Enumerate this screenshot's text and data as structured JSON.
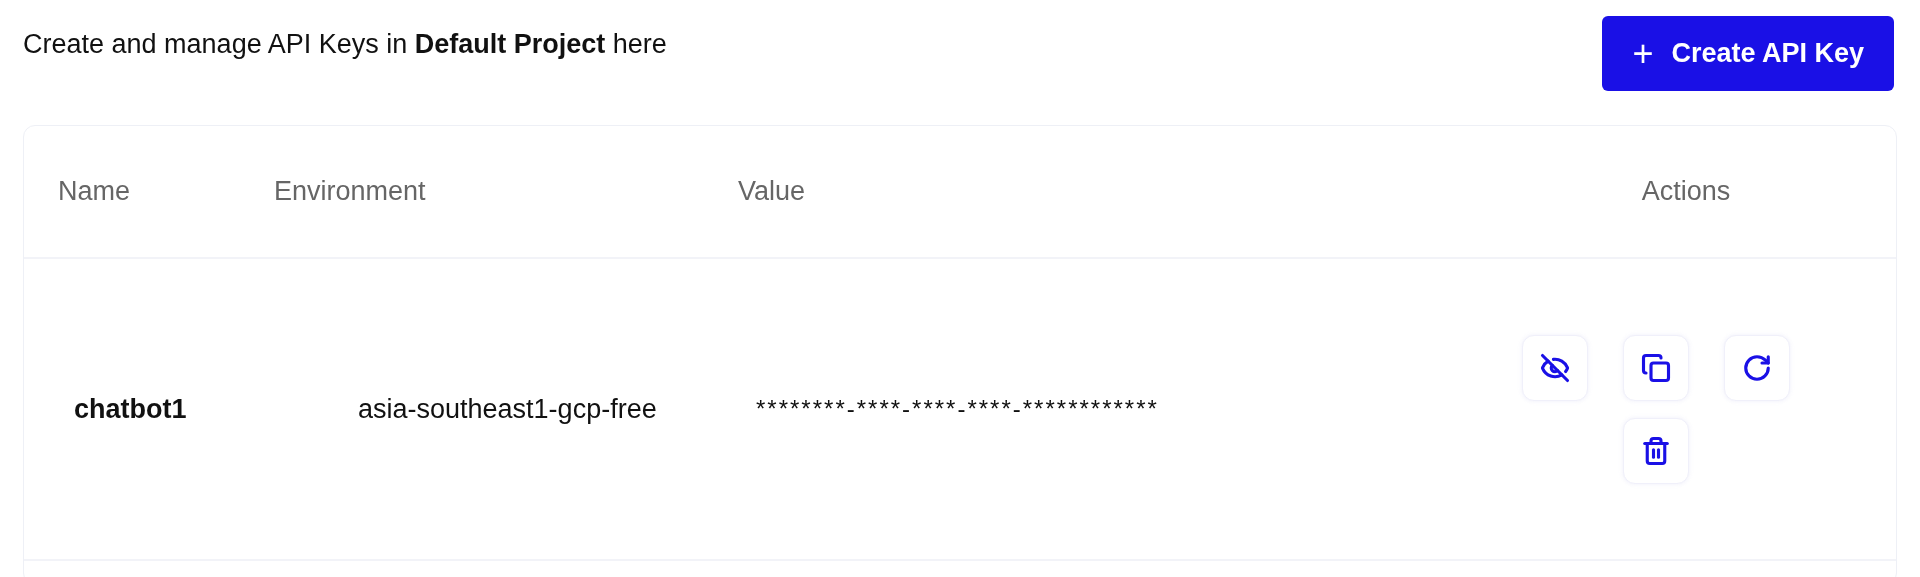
{
  "intro": "Create and manage API Keys in **Default Project** here",
  "create_button": {
    "icon": "+",
    "label": "Create API Key"
  },
  "table": {
    "columns": [
      "Name",
      "Environment",
      "Value",
      "Actions"
    ],
    "rows": [
      {
        "name": "chatbot1",
        "environment": "asia-southeast1-gcp-free",
        "value": "********-****-****-****-************",
        "actions": [
          {
            "kind": "hide"
          },
          {
            "kind": "copy"
          },
          {
            "kind": "rotate"
          },
          {
            "kind": "delete"
          }
        ]
      }
    ]
  }
}
